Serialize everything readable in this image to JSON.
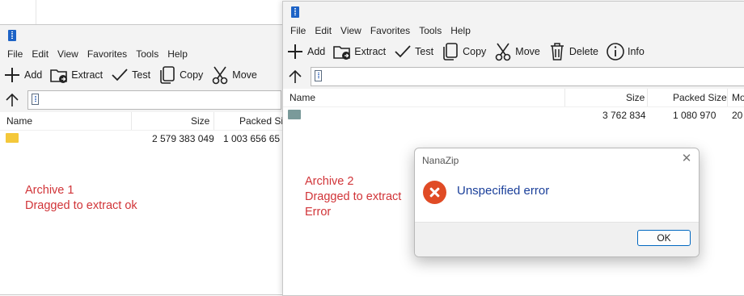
{
  "window1": {
    "menu": [
      "File",
      "Edit",
      "View",
      "Favorites",
      "Tools",
      "Help"
    ],
    "toolbar": [
      {
        "icon": "add-icon",
        "label": "Add"
      },
      {
        "icon": "extract-icon",
        "label": "Extract"
      },
      {
        "icon": "test-icon",
        "label": "Test"
      },
      {
        "icon": "copy-icon",
        "label": "Copy"
      },
      {
        "icon": "move-icon",
        "label": "Move"
      }
    ],
    "columns": {
      "name": "Name",
      "size": "Size",
      "packed": "Packed Siz"
    },
    "rows": [
      {
        "name": "",
        "size": "2 579 383 049",
        "packed": "1 003 656 65"
      }
    ],
    "note": {
      "line1": "Archive 1",
      "line2": "Dragged to extract ok"
    }
  },
  "window2": {
    "menu": [
      "File",
      "Edit",
      "View",
      "Favorites",
      "Tools",
      "Help"
    ],
    "toolbar": [
      {
        "icon": "add-icon",
        "label": "Add"
      },
      {
        "icon": "extract-icon",
        "label": "Extract"
      },
      {
        "icon": "test-icon",
        "label": "Test"
      },
      {
        "icon": "copy-icon",
        "label": "Copy"
      },
      {
        "icon": "move-icon",
        "label": "Move"
      },
      {
        "icon": "delete-icon",
        "label": "Delete"
      },
      {
        "icon": "info-icon",
        "label": "Info"
      }
    ],
    "columns": {
      "name": "Name",
      "size": "Size",
      "packed": "Packed Size",
      "modified": "Mo"
    },
    "rows": [
      {
        "name": "",
        "size": "3 762 834",
        "packed": "1 080 970",
        "modified": "20"
      }
    ],
    "note": {
      "line1": "Archive 2",
      "line2": "Dragged to extract",
      "line3": "Error"
    }
  },
  "dialog": {
    "title": "NanaZip",
    "message": "Unspecified error",
    "ok_label": "OK",
    "icon": "error-icon"
  },
  "colors": {
    "folder1": "#f4c83a",
    "folder2": "#7a9a9a",
    "note": "#d13438",
    "error": "#e04b25",
    "link": "#1a3f9a"
  }
}
